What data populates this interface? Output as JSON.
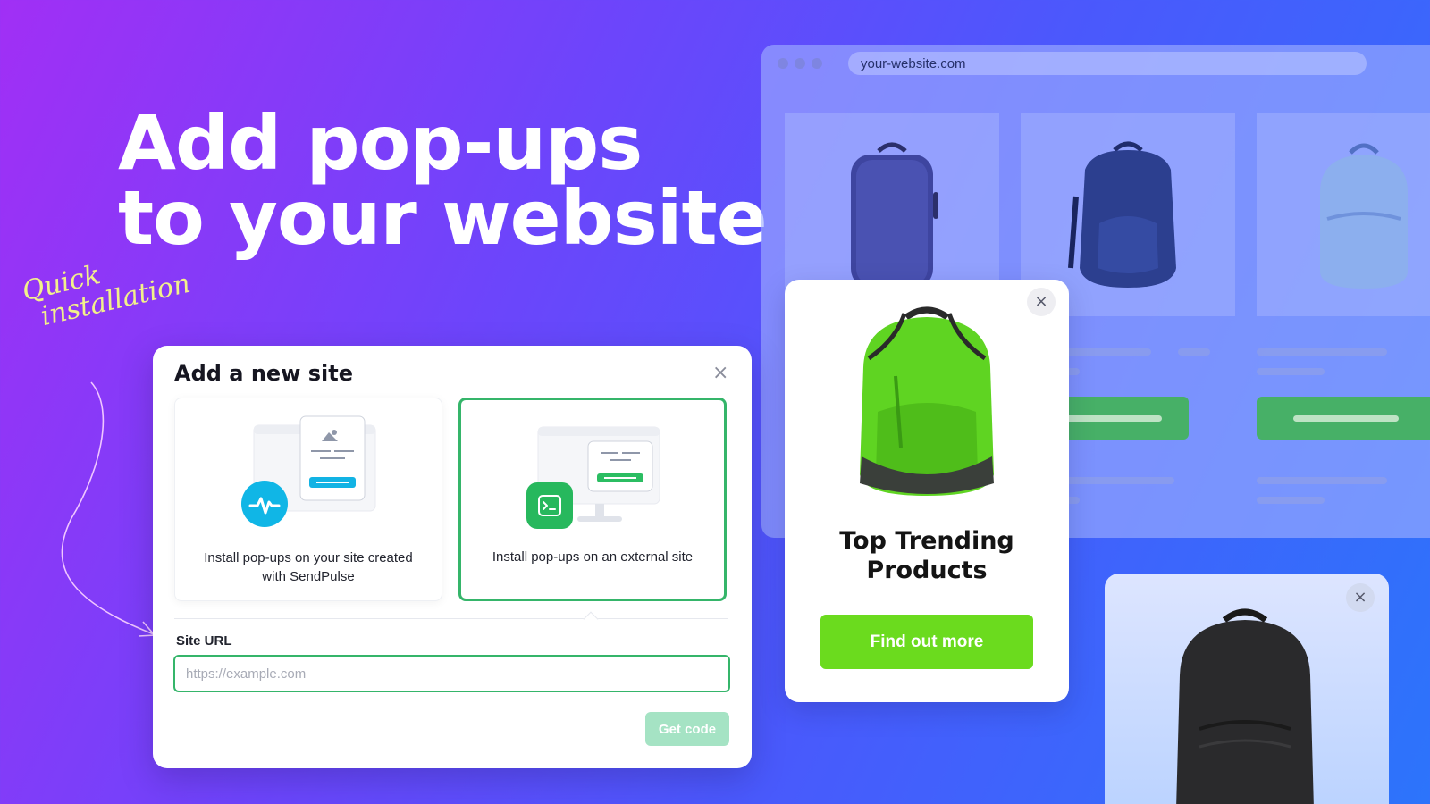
{
  "headline": {
    "line1": "Add pop-ups",
    "line2": "to your website"
  },
  "annotation": {
    "line1": "Quick",
    "line2": "installation"
  },
  "browser": {
    "url": "your-website.com"
  },
  "popup": {
    "title": "Top Trending Products",
    "cta_label": "Find out more",
    "close_glyph": "×"
  },
  "card3": {
    "close_glyph": "×"
  },
  "dialog": {
    "title": "Add a new site",
    "close_glyph": "×",
    "options": [
      {
        "label": "Install pop-ups on your site created with SendPulse",
        "icon": "sendpulse-pulse-icon",
        "selected": false
      },
      {
        "label": "Install pop-ups on an external site",
        "icon": "terminal-icon",
        "selected": true
      }
    ],
    "site_url_label": "Site URL",
    "site_url_placeholder": "https://example.com",
    "site_url_value": "",
    "get_code_label": "Get code"
  },
  "colors": {
    "accent_green": "#35b56a",
    "cta_green": "#6bdb1e",
    "disabled_green": "#a5e3c4",
    "sendpulse_blue": "#10b6e6"
  }
}
